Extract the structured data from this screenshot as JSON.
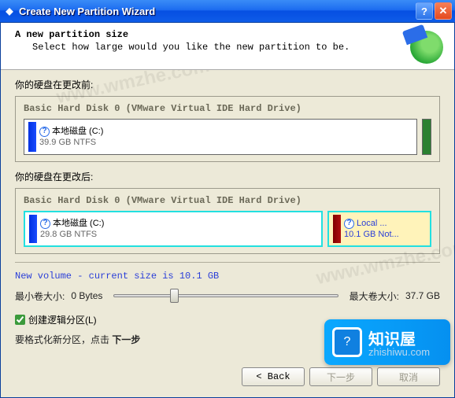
{
  "titlebar": {
    "title": "Create New Partition Wizard"
  },
  "header": {
    "heading": "A new partition size",
    "sub": "Select how large would you like the new partition to be."
  },
  "before": {
    "label": "你的硬盘在更改前:",
    "disk_title": "Basic Hard Disk 0 (VMware Virtual IDE Hard Drive)",
    "part": {
      "name": "本地磁盘 (C:)",
      "size": "39.9 GB NTFS"
    }
  },
  "after": {
    "label": "你的硬盘在更改后:",
    "disk_title": "Basic Hard Disk 0 (VMware Virtual IDE Hard Drive)",
    "part_main": {
      "name": "本地磁盘 (C:)",
      "size": "29.8 GB NTFS"
    },
    "part_new": {
      "name": "Local ...",
      "size": "10.1 GB Not..."
    }
  },
  "slider": {
    "title": "New volume - current size is 10.1 GB",
    "min_label": "最小卷大小:",
    "min_value": "0 Bytes",
    "max_label": "最大卷大小:",
    "max_value": "37.7 GB"
  },
  "checkbox": {
    "label": "创建逻辑分区(L)"
  },
  "instruction": {
    "prefix": "要格式化新分区，点击 ",
    "bold": "下一步"
  },
  "buttons": {
    "back": "< Back",
    "next": "下一步",
    "cancel": "取消"
  },
  "watermark": {
    "title": "知识屋",
    "url": "zhishiwu.com"
  }
}
